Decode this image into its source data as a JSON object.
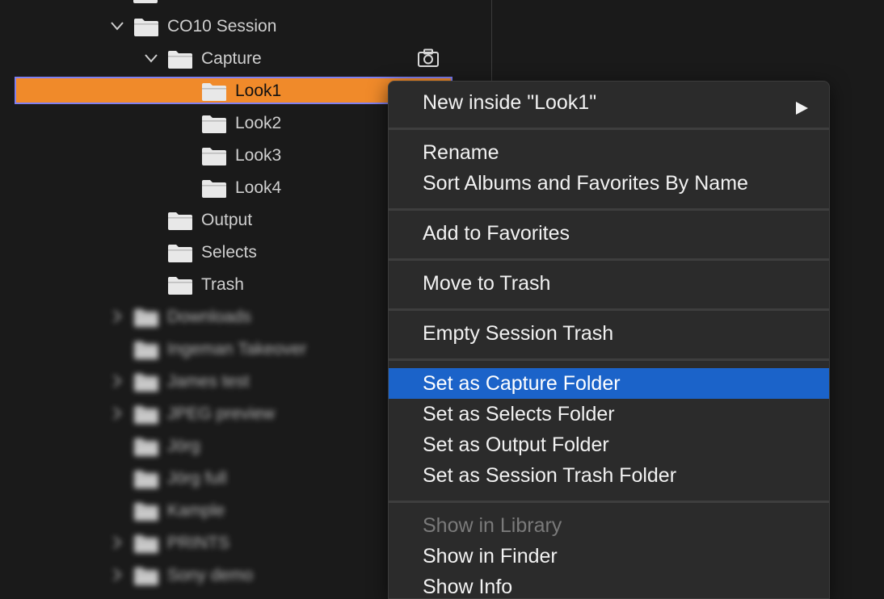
{
  "tree": {
    "session": {
      "label": "CO10 Session",
      "icon": "folder-icon",
      "expanded": true
    },
    "capture": {
      "label": "Capture",
      "icon": "folder-icon",
      "expanded": true,
      "badge_icon": "camera-icon"
    },
    "looks": [
      {
        "label": "Look1",
        "selected": true
      },
      {
        "label": "Look2"
      },
      {
        "label": "Look3"
      },
      {
        "label": "Look4"
      }
    ],
    "session_folders": [
      {
        "label": "Output"
      },
      {
        "label": "Selects"
      },
      {
        "label": "Trash"
      }
    ],
    "blurred_items": [
      {
        "label": "Downloads",
        "has_chevron": true
      },
      {
        "label": "Ingeman Takeover",
        "has_chevron": false
      },
      {
        "label": "James test",
        "has_chevron": true
      },
      {
        "label": "JPEG preview",
        "has_chevron": true
      },
      {
        "label": "Jörg",
        "has_chevron": false
      },
      {
        "label": "Jörg full",
        "has_chevron": false
      },
      {
        "label": "Kample",
        "has_chevron": false
      },
      {
        "label": "PRINTS",
        "has_chevron": true
      },
      {
        "label": "Sony demo",
        "has_chevron": true
      }
    ]
  },
  "context_menu": {
    "groups": [
      [
        {
          "label": "New inside \"Look1\"",
          "submenu": true
        }
      ],
      [
        {
          "label": "Rename"
        },
        {
          "label": "Sort Albums and Favorites By Name"
        }
      ],
      [
        {
          "label": "Add to Favorites"
        }
      ],
      [
        {
          "label": "Move to Trash"
        }
      ],
      [
        {
          "label": "Empty Session Trash"
        }
      ],
      [
        {
          "label": "Set as Capture Folder",
          "highlighted": true
        },
        {
          "label": "Set as Selects Folder"
        },
        {
          "label": "Set as Output Folder"
        },
        {
          "label": "Set as Session Trash Folder"
        }
      ],
      [
        {
          "label": "Show in Library",
          "disabled": true
        },
        {
          "label": "Show in Finder"
        },
        {
          "label": "Show Info"
        }
      ]
    ]
  },
  "colors": {
    "selection_orange": "#f08a2a",
    "selection_outline": "#7f7ff0",
    "menu_highlight": "#1b63c9",
    "menu_background": "#2b2b2b",
    "pane_background": "#1a1a1a"
  }
}
